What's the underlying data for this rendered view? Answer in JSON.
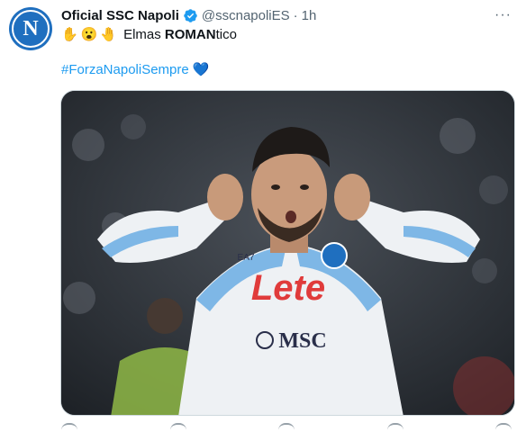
{
  "tweet": {
    "author_name": "Oficial SSC Napoli",
    "author_handle": "@sscnapoliES",
    "separator": "·",
    "time": "1h",
    "more_label": "···",
    "emojis": [
      "✋",
      "😮",
      "🤚"
    ],
    "text_plain": "Elmas ",
    "text_bold": "ROMAN",
    "text_rest": "tico",
    "hashtag": "#ForzaNapoliSempre",
    "heart": "💙"
  },
  "photo": {
    "sponsor_main": "Lete",
    "sponsor_secondary": "MSC",
    "kit_brand": "EA7"
  },
  "colors": {
    "link": "#1d9bf0",
    "secondary_text": "#536471",
    "verified": "#1d9bf0",
    "avatar_bg": "#1f6fbf"
  },
  "icons": {
    "verified": "verified-badge-icon",
    "more": "more-options-icon",
    "avatar": "napoli-logo-avatar"
  }
}
